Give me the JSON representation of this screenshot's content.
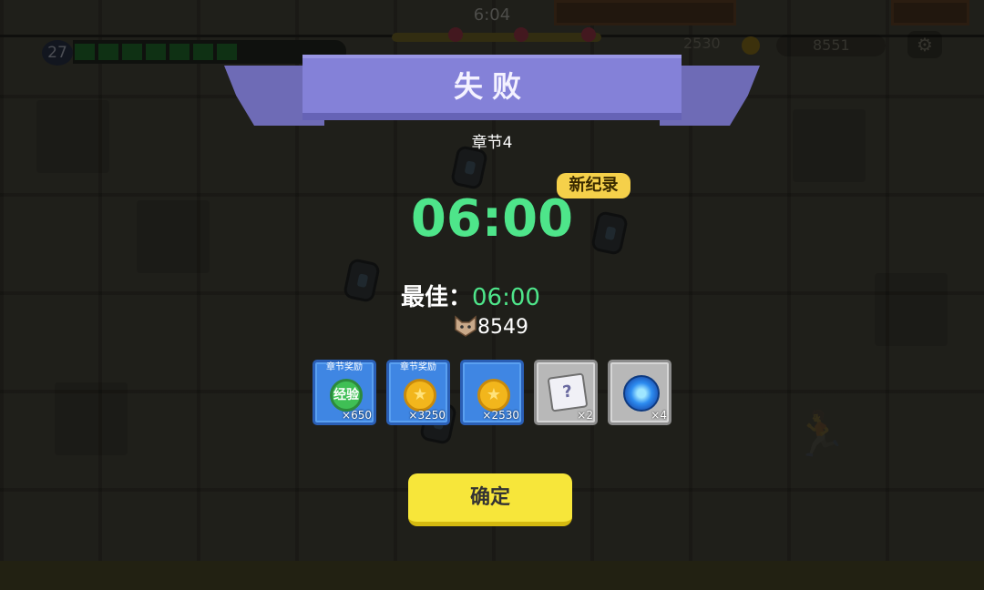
{
  "hud": {
    "time": "6:04",
    "level": "27",
    "xp_fraction": 0.53,
    "coins": "2530",
    "kills": "8551",
    "settings_icon": "gear-icon"
  },
  "dialog": {
    "title": "失败",
    "chapter": "章节4",
    "new_record_badge": "新纪录",
    "survival_time": "06:00",
    "best_label": "最佳：",
    "best_time": "06:00",
    "kills": "8549",
    "kills_icon": "cat-head-icon",
    "rewards": [
      {
        "tag": "章节奖励",
        "icon": "exp-badge-icon",
        "icon_text": "经验",
        "count": "×650",
        "frame": "blue"
      },
      {
        "tag": "章节奖励",
        "icon": "gold-coin-icon",
        "count": "×3250",
        "frame": "blue"
      },
      {
        "tag": "",
        "icon": "gold-coin-icon",
        "count": "×2530",
        "frame": "blue"
      },
      {
        "tag": "",
        "icon": "mystery-scroll-icon",
        "icon_text": "?",
        "count": "×2",
        "frame": "gray"
      },
      {
        "tag": "",
        "icon": "blue-orb-icon",
        "count": "×4",
        "frame": "gray"
      }
    ],
    "confirm_label": "确定"
  },
  "colors": {
    "accent_green": "#4ee58a",
    "banner_purple": "#8481d8",
    "button_yellow": "#f7e63a",
    "badge_yellow": "#f5d04a"
  }
}
